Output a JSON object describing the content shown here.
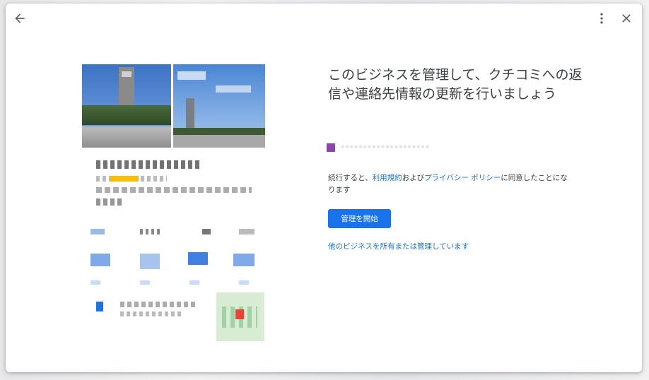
{
  "dialog": {
    "title": "このビジネスを管理して、クチコミへの返信や連絡先情報の更新を行いましょう",
    "account_email": "••••••••••••••••••••",
    "terms": {
      "prefix": "続行すると、",
      "terms_link": "利用規約",
      "and": "および",
      "privacy_link": "プライバシー ポリシー",
      "suffix": "に同意したことになります"
    },
    "primary_button": "管理を開始",
    "other_business_link": "他のビジネスを所有または管理しています"
  },
  "colors": {
    "accent": "#1a73e8",
    "rating": "#fbbc04",
    "map_pin": "#ea4335",
    "account_icon": "#8e44ad"
  },
  "icons": {
    "back": "arrow-left",
    "more": "more-vert",
    "close": "close"
  }
}
